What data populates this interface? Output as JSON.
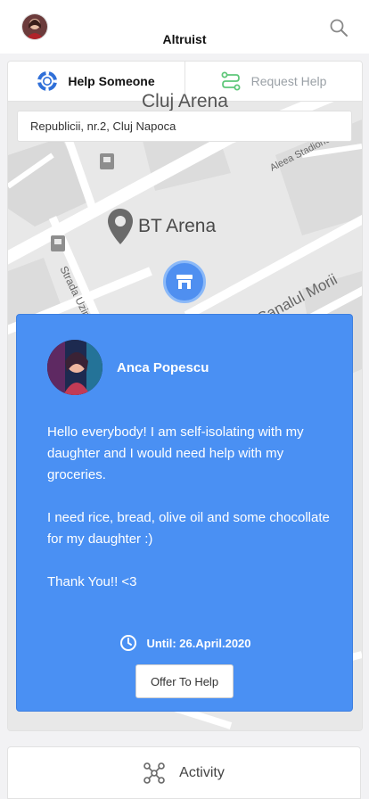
{
  "header": {
    "app_title": "Altruist"
  },
  "tabs": [
    {
      "label": "Help Someone",
      "active": true
    },
    {
      "label": "Request Help",
      "active": false
    }
  ],
  "map": {
    "address": "Republicii, nr.2, Cluj Napoca",
    "labels": {
      "arena_top": "Cluj Arena",
      "poi": "BT Arena",
      "street_stadion": "Aleea Stadionului",
      "street_canal": "Canalul Morii",
      "street_uzinei": "Strada Uzinei"
    }
  },
  "request": {
    "name": "Anca Popescu",
    "message": "Hello everybody! I am self-isolating with my daughter and I would need help with my groceries.\n\nI need rice, bread, olive oil and some chocollate for my daughter :)\n\nThank You!! <3",
    "until": "Until: 26.April.2020",
    "offer_label": "Offer To Help"
  },
  "bottom_nav": {
    "label": "Activity"
  },
  "colors": {
    "accent": "#4a90f3",
    "request_tab_icon": "#5fc77a",
    "map_bg": "#e8e8e8"
  },
  "icons": [
    "search-icon",
    "lifebuoy-icon",
    "route-icon",
    "location-pin-icon",
    "store-icon",
    "clock-icon",
    "network-icon"
  ]
}
